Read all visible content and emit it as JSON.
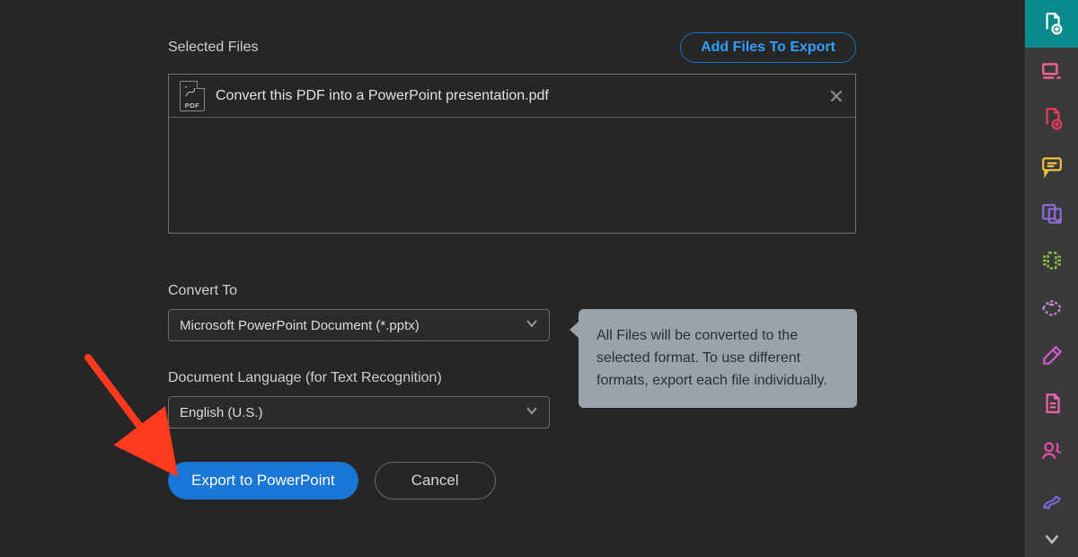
{
  "header": {
    "selected_files_label": "Selected Files",
    "add_files_label": "Add Files To Export"
  },
  "files": [
    {
      "name": "Convert this PDF into a PowerPoint presentation.pdf",
      "icon_label": "PDF"
    }
  ],
  "convert": {
    "label": "Convert To",
    "value": "Microsoft PowerPoint Document (*.pptx)"
  },
  "language": {
    "label": "Document Language (for Text Recognition)",
    "value": "English (U.S.)"
  },
  "tooltip": {
    "text": "All Files will be converted to the selected format. To use different formats, export each file individually."
  },
  "buttons": {
    "export": "Export to PowerPoint",
    "cancel": "Cancel"
  },
  "toolbar": {
    "items": [
      {
        "name": "create-pdf-icon",
        "color": "#ffffff",
        "active": true
      },
      {
        "name": "combine-icon",
        "color": "#f06292"
      },
      {
        "name": "edit-pdf-icon",
        "color": "#ec3b5c"
      },
      {
        "name": "comment-icon",
        "color": "#f4c543"
      },
      {
        "name": "organize-icon",
        "color": "#8e6cd8"
      },
      {
        "name": "compress-icon",
        "color": "#8bc34a"
      },
      {
        "name": "redact-icon",
        "color": "#c58bd6"
      },
      {
        "name": "fill-sign-icon",
        "color": "#d15bd1"
      },
      {
        "name": "export-pdf-icon",
        "color": "#ec66b0"
      },
      {
        "name": "send-sign-icon",
        "color": "#e84fa1"
      },
      {
        "name": "sign-pen-icon",
        "color": "#7a68d8"
      }
    ]
  }
}
